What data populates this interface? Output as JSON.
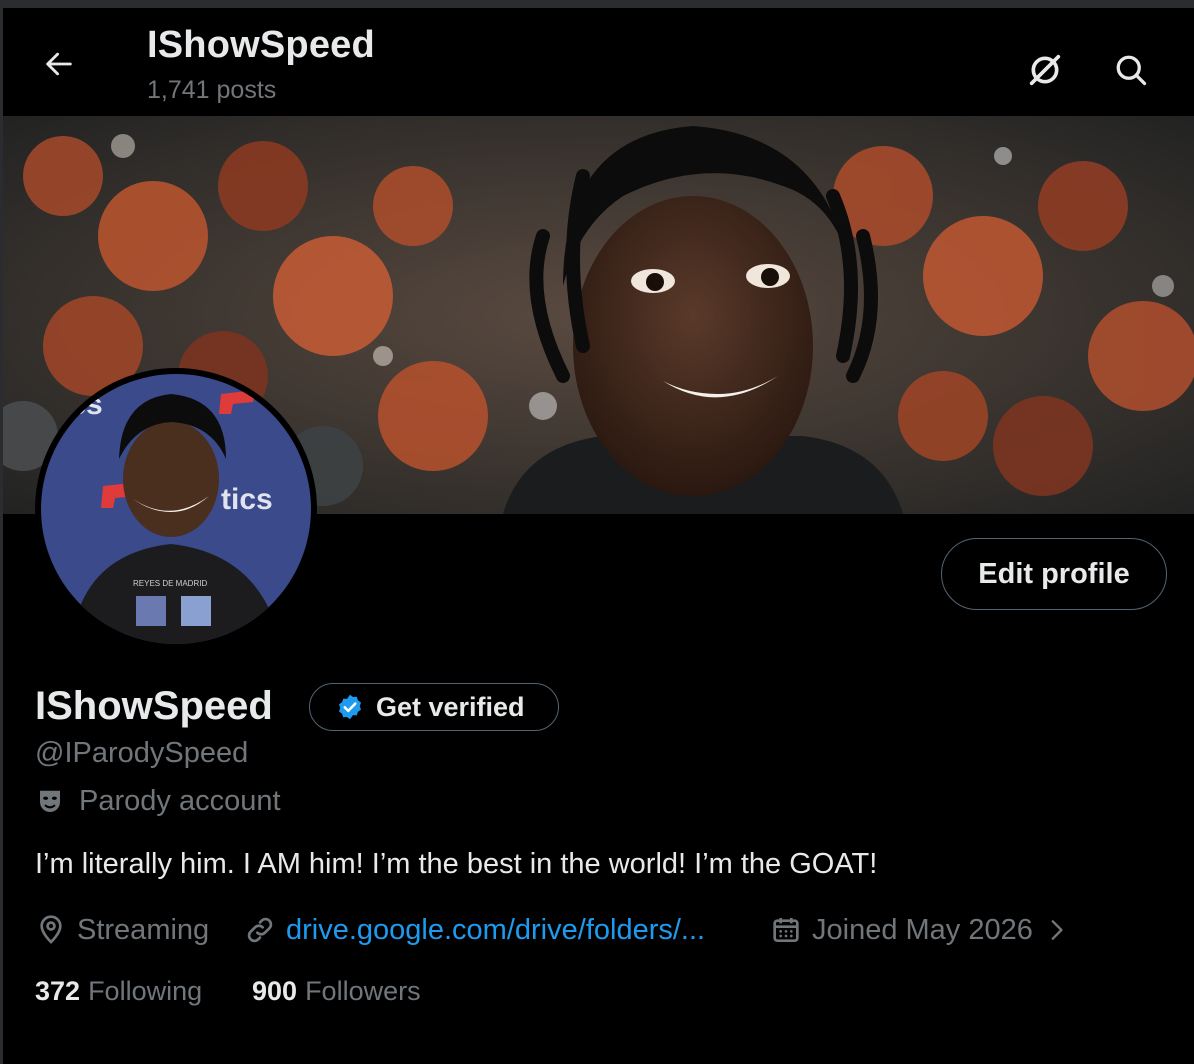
{
  "header": {
    "title": "IShowSpeed",
    "post_count": "1,741 posts"
  },
  "profile": {
    "display_name": "IShowSpeed",
    "handle": "@IParodySpeed",
    "label": "Parody account",
    "bio": "I’m literally him. I AM him! I’m the best in the world! I’m the GOAT!",
    "location": "Streaming",
    "website": "drive.google.com/drive/folders/...",
    "joined": "Joined May 2026",
    "avatar_shirt_text": "REYES DE MADRID",
    "following_count": "372",
    "following_label": "Following",
    "followers_count": "900",
    "followers_label": "Followers"
  },
  "buttons": {
    "edit_profile": "Edit profile",
    "get_verified": "Get verified"
  },
  "colors": {
    "background": "#000000",
    "text_primary": "#e7e9ea",
    "text_secondary": "#71767b",
    "link": "#1d9bf0",
    "border": "#536471",
    "verified_badge": "#1d9bf0"
  },
  "icons": [
    "back-arrow-icon",
    "grok-icon",
    "search-icon",
    "verified-badge-icon",
    "parody-mask-icon",
    "location-pin-icon",
    "link-icon",
    "calendar-icon",
    "chevron-right-icon"
  ]
}
